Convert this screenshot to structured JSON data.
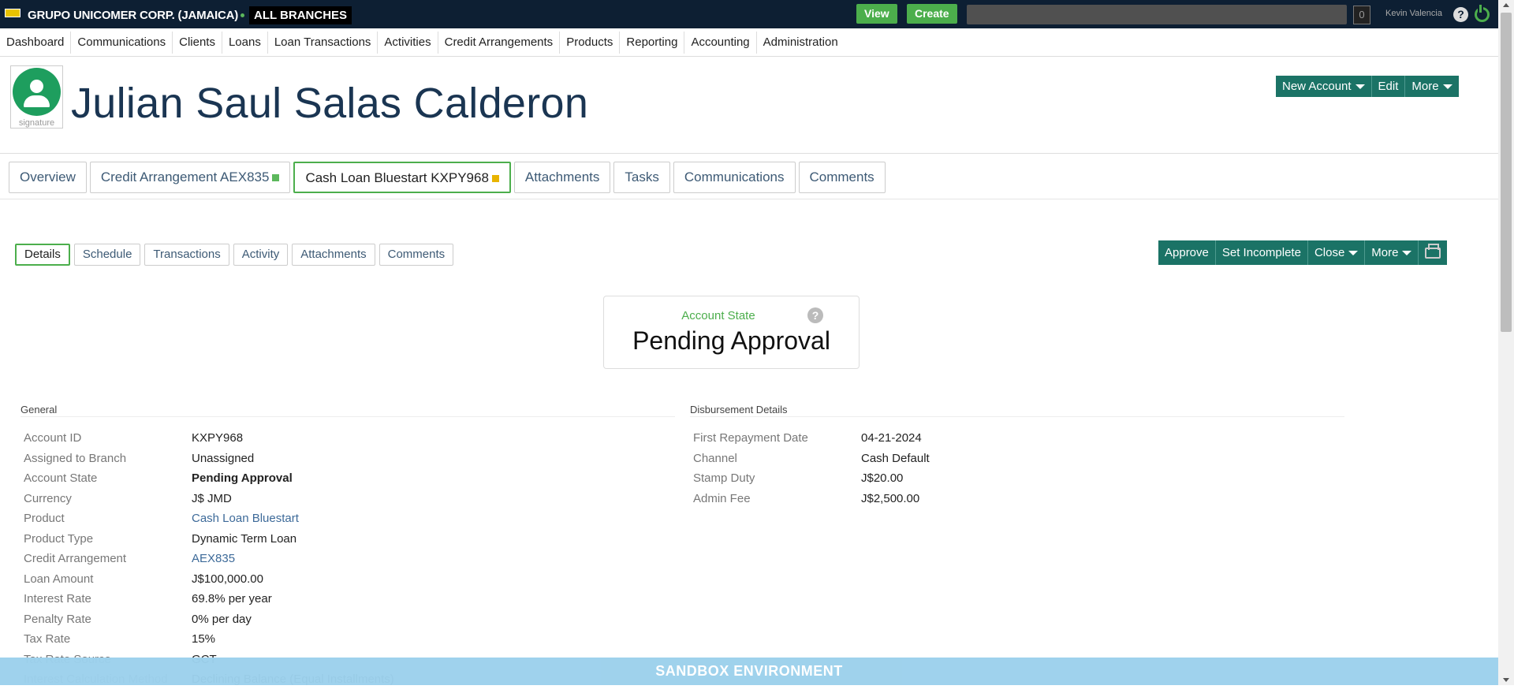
{
  "topbar": {
    "org": "GRUPO UNICOMER CORP. (JAMAICA)",
    "branch": "ALL BRANCHES",
    "view_label": "View",
    "create_label": "Create",
    "notifications_count": "0",
    "user": "Kevin Valencia",
    "help_glyph": "?"
  },
  "nav": [
    "Dashboard",
    "Communications",
    "Clients",
    "Loans",
    "Loan Transactions",
    "Activities",
    "Credit Arrangements",
    "Products",
    "Reporting",
    "Accounting",
    "Administration"
  ],
  "client": {
    "name": "Julian Saul Salas Calderon",
    "signature_label": "signature",
    "actions": {
      "new_account": "New Account",
      "edit": "Edit",
      "more": "More"
    }
  },
  "account_tabs": [
    {
      "label": "Overview"
    },
    {
      "label": "Credit Arrangement AEX835",
      "marker_color": "#5cb85c"
    },
    {
      "label": "Cash Loan Bluestart KXPY968",
      "marker_color": "#e8b400",
      "active": true
    },
    {
      "label": "Attachments"
    },
    {
      "label": "Tasks"
    },
    {
      "label": "Communications"
    },
    {
      "label": "Comments"
    }
  ],
  "sub_tabs": [
    "Details",
    "Schedule",
    "Transactions",
    "Activity",
    "Attachments",
    "Comments"
  ],
  "account_actions": {
    "approve": "Approve",
    "set_incomplete": "Set Incomplete",
    "close": "Close",
    "more": "More"
  },
  "account_state": {
    "label": "Account State",
    "value": "Pending Approval"
  },
  "general": {
    "title": "General",
    "rows": [
      {
        "k": "Account ID",
        "v": "KXPY968"
      },
      {
        "k": "Assigned to Branch",
        "v": "Unassigned"
      },
      {
        "k": "Account State",
        "v": "Pending Approval"
      },
      {
        "k": "Currency",
        "v": "J$ JMD"
      },
      {
        "k": "Product",
        "v": "Cash Loan Bluestart"
      },
      {
        "k": "Product Type",
        "v": "Dynamic Term Loan"
      },
      {
        "k": "Credit Arrangement",
        "v": "AEX835"
      },
      {
        "k": "Loan Amount",
        "v": "J$100,000.00"
      },
      {
        "k": "Interest Rate",
        "v": "69.8% per year"
      },
      {
        "k": "Penalty Rate",
        "v": "0% per day"
      },
      {
        "k": "Tax Rate",
        "v": "15%"
      },
      {
        "k": "Tax Rate Source",
        "v": "GCT"
      },
      {
        "k": "Interest Calculation Method",
        "v": "Declining Balance (Equal Installments)"
      }
    ]
  },
  "disbursement": {
    "title": "Disbursement Details",
    "rows": [
      {
        "k": "First Repayment Date",
        "v": "04-21-2024"
      },
      {
        "k": "Channel",
        "v": "Cash Default"
      },
      {
        "k": "Stamp Duty",
        "v": "J$20.00"
      },
      {
        "k": "Admin Fee",
        "v": "J$2,500.00"
      }
    ]
  },
  "sandbox_banner": "SANDBOX ENVIRONMENT"
}
